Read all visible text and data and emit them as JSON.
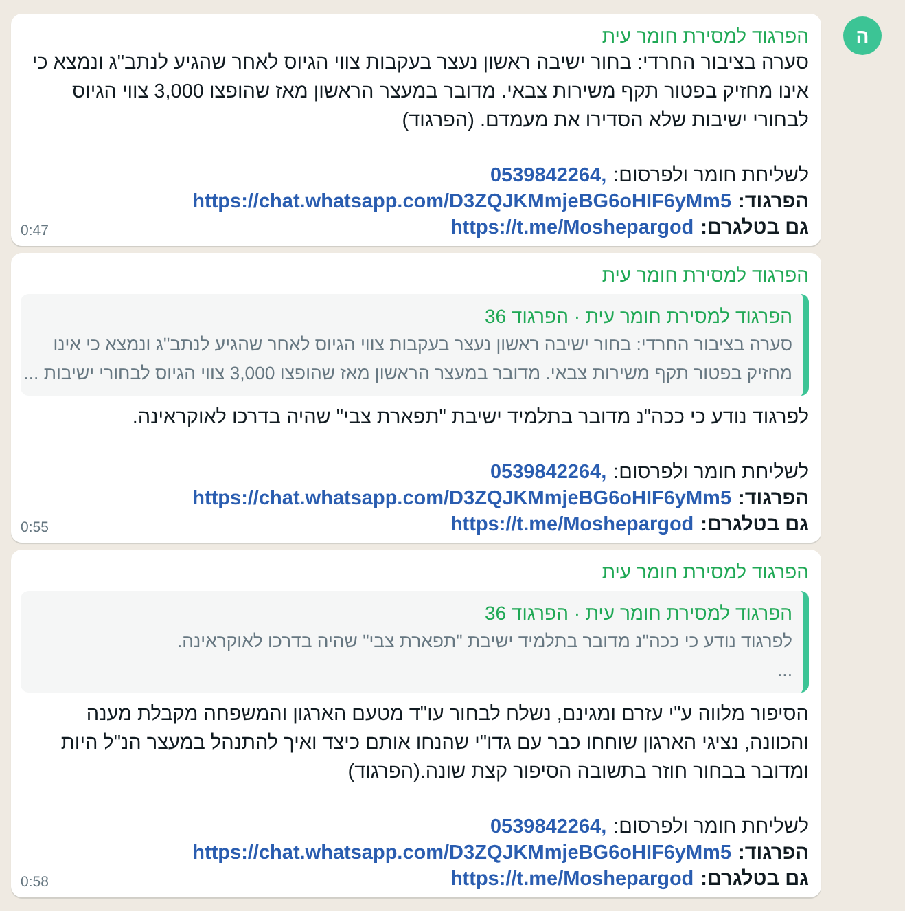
{
  "messages": [
    {
      "avatar": "ה",
      "sender": "הפרגוד למסירת חומר עית",
      "body": [
        "סערה בציבור החרדי: בחור ישיבה ראשון נעצר בעקבות צווי הגיוס לאחר שהגיע לנתב\"ג ונמצא כי",
        "אינו מחזיק בפטור תקף משירות צבאי. מדובר במעצר הראשון מאז שהופצו 3,000 צווי הגיוס",
        "לבחורי ישיבות שלא הסדירו את מעמדם. (הפרגוד)"
      ],
      "contact_label": "לשליחת חומר ולפרסום:",
      "phone": "0539842264,",
      "group_label": "הפרגוד:",
      "group_link": "https://chat.whatsapp.com/D3ZQJKMmjeBG6oHIF6yMm5",
      "telegram_label": "גם בטלגרם:",
      "telegram_link": "https://t.me/Moshepargod",
      "time": "0:47"
    },
    {
      "sender": "הפרגוד למסירת חומר עית",
      "quote": {
        "sender": "הפרגוד למסירת חומר עית · הפרגוד 36",
        "lines": [
          "סערה בציבור החרדי: בחור ישיבה ראשון נעצר  בעקבות צווי הגיוס לאחר שהגיע לנתב\"ג ונמצא כי אינו",
          "מחזיק בפטור תקף משירות צבאי. מדובר במעצר הראשון מאז שהופצו 3,000 צווי הגיוס לבחורי ישיבות ..."
        ]
      },
      "body": [
        "לפרגוד נודע כי ככה\"נ מדובר בתלמיד ישיבת \"תפארת צבי\" שהיה בדרכו לאוקראינה."
      ],
      "contact_label": "לשליחת חומר ולפרסום:",
      "phone": "0539842264,",
      "group_label": "הפרגוד:",
      "group_link": "https://chat.whatsapp.com/D3ZQJKMmjeBG6oHIF6yMm5",
      "telegram_label": "גם בטלגרם:",
      "telegram_link": "https://t.me/Moshepargod",
      "time": "0:55"
    },
    {
      "sender": "הפרגוד למסירת חומר עית",
      "quote": {
        "sender": "הפרגוד למסירת חומר עית · הפרגוד 36",
        "lines": [
          "לפרגוד נודע כי ככה\"נ מדובר בתלמיד  ישיבת \"תפארת צבי\" שהיה בדרכו לאוקראינה.",
          "..."
        ]
      },
      "body": [
        "הסיפור מלווה ע\"י עזרם ומגינם, נשלח לבחור עו\"ד מטעם הארגון והמשפחה מקבלת מענה",
        "והכוונה, נציגי הארגון שוחחו כבר עם גדו\"י שהנחו אותם כיצד ואיך להתנהל במעצר הנ\"ל היות",
        "ומדובר בבחור חוזר בתשובה הסיפור קצת שונה.(הפרגוד)"
      ],
      "contact_label": "לשליחת חומר ולפרסום:",
      "phone": "0539842264,",
      "group_label": "הפרגוד:",
      "group_link": "https://chat.whatsapp.com/D3ZQJKMmjeBG6oHIF6yMm5",
      "telegram_label": "גם בטלגרם:",
      "telegram_link": "https://t.me/Moshepargod",
      "time": "0:58"
    }
  ]
}
